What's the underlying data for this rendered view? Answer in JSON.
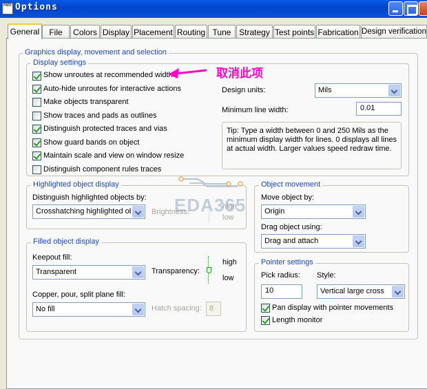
{
  "window": {
    "title": "Options",
    "app_icon_text": "PADS"
  },
  "tabs": [
    "General",
    "File",
    "Colors",
    "Display",
    "Placement",
    "Routing",
    "Tune",
    "Strategy",
    "Test points",
    "Fabrication",
    "Design verification"
  ],
  "active_tab": "General",
  "graphics": {
    "title": "Graphics display, movement and selection",
    "display_settings": {
      "title": "Display settings",
      "items": [
        {
          "label": "Show unroutes at recommended width",
          "checked": true
        },
        {
          "label": "Auto-hide unroutes for interactive actions",
          "checked": true
        },
        {
          "label": "Make objects transparent",
          "checked": false
        },
        {
          "label": "Show traces and pads as outlines",
          "checked": false
        },
        {
          "label": "Distinguish protected traces and vias",
          "checked": true
        },
        {
          "label": "Show guard bands on object",
          "checked": true
        },
        {
          "label": "Maintain scale and view on window resize",
          "checked": true
        },
        {
          "label": "Distinguish component rules traces",
          "checked": false
        }
      ]
    },
    "design_units": {
      "label": "Design units:",
      "value": "Mils"
    },
    "min_line_width": {
      "label": "Minimum line width:",
      "value": "0.01"
    },
    "tip": "Tip: Type a width between 0 and 250 Mils as the minimum display width for lines. 0 displays all lines at actual width. Larger values speed redraw time.",
    "highlighted": {
      "title": "Highlighted object display",
      "distinguish_label": "Distinguish highlighted objects by:",
      "distinguish_value": "Crosshatching highlighted objects",
      "brightness_label": "Brightness:",
      "high": "high",
      "low": "low"
    },
    "filled": {
      "title": "Filled object display",
      "keepout_label": "Keepout fill:",
      "keepout_value": "Transparent",
      "transparency_label": "Transparency:",
      "high": "high",
      "low": "low",
      "copper_label": "Copper, pour, split plane fill:",
      "copper_value": "No fill",
      "hatch_label": "Hatch spacing:",
      "hatch_value": "8"
    },
    "movement": {
      "title": "Object movement",
      "move_label": "Move object by:",
      "move_value": "Origin",
      "drag_label": "Drag object using:",
      "drag_value": "Drag and attach"
    },
    "pointer": {
      "title": "Pointer settings",
      "pick_label": "Pick radius:",
      "pick_value": "10",
      "style_label": "Style:",
      "style_value": "Vertical large cross",
      "pan_label": "Pan display with pointer movements",
      "pan_checked": true,
      "length_label": "Length monitor",
      "length_checked": true
    }
  },
  "annotation": {
    "text": "取消此项",
    "color": "#ff00c8"
  },
  "watermark": "EDA365",
  "colors": {
    "group_title": "#1d47b8",
    "titlebar": "#0a52d8",
    "tab_highlight": "#ffc73c"
  }
}
